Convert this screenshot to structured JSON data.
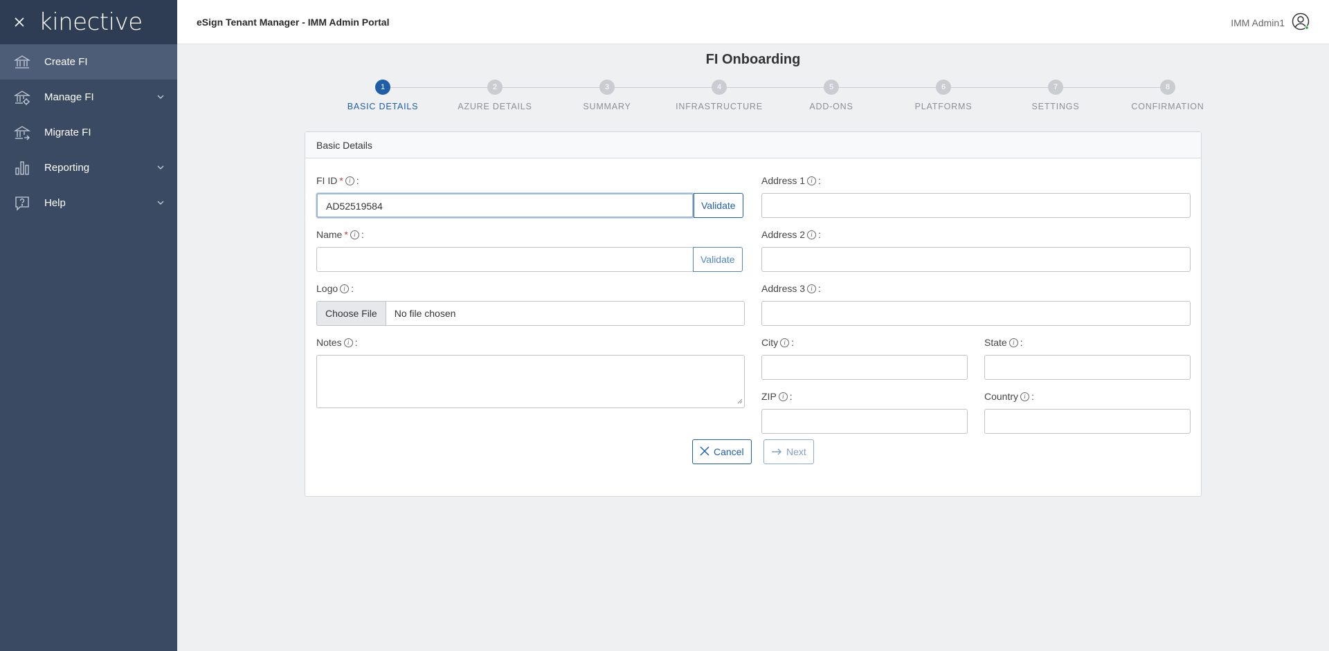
{
  "sidebar": {
    "logo": "kinective",
    "items": [
      {
        "label": "Create FI",
        "icon": "bank-icon",
        "active": true
      },
      {
        "label": "Manage FI",
        "icon": "bank-settings-icon",
        "expandable": true
      },
      {
        "label": "Migrate FI",
        "icon": "bank-migrate-icon"
      },
      {
        "label": "Reporting",
        "icon": "bar-chart-icon",
        "expandable": true
      },
      {
        "label": "Help",
        "icon": "help-icon",
        "expandable": true
      }
    ]
  },
  "header": {
    "title": "eSign Tenant Manager - IMM Admin Portal",
    "user": "IMM Admin1"
  },
  "page": {
    "title": "FI Onboarding"
  },
  "stepper": {
    "steps": [
      {
        "num": "1",
        "label": "BASIC DETAILS",
        "active": true
      },
      {
        "num": "2",
        "label": "AZURE DETAILS"
      },
      {
        "num": "3",
        "label": "SUMMARY"
      },
      {
        "num": "4",
        "label": "INFRASTRUCTURE"
      },
      {
        "num": "5",
        "label": "ADD-ONS"
      },
      {
        "num": "6",
        "label": "PLATFORMS"
      },
      {
        "num": "7",
        "label": "SETTINGS"
      },
      {
        "num": "8",
        "label": "CONFIRMATION"
      }
    ]
  },
  "form": {
    "section_title": "Basic Details",
    "fi_id": {
      "label": "FI ID",
      "required": "*",
      "suffix": ":",
      "value": "AD52519584",
      "validate": "Validate"
    },
    "name": {
      "label": "Name",
      "required": "*",
      "suffix": ":",
      "value": "",
      "validate": "Validate"
    },
    "logo": {
      "label": "Logo",
      "suffix": ":",
      "button": "Choose File",
      "status": "No file chosen"
    },
    "notes": {
      "label": "Notes",
      "suffix": ":"
    },
    "address1": {
      "label": "Address 1",
      "suffix": ":"
    },
    "address2": {
      "label": "Address 2",
      "suffix": ":"
    },
    "address3": {
      "label": "Address 3",
      "suffix": ":"
    },
    "city": {
      "label": "City",
      "suffix": ":"
    },
    "state": {
      "label": "State",
      "suffix": ":"
    },
    "zip": {
      "label": "ZIP",
      "suffix": ":"
    },
    "country": {
      "label": "Country",
      "suffix": ":"
    },
    "info_glyph": "i"
  },
  "actions": {
    "cancel": "Cancel",
    "next": "Next"
  },
  "colors": {
    "sidebar_bg": "#3a4a62",
    "accent": "#1e5ea8",
    "required": "#d3343a",
    "status_online": "#2ea44f"
  }
}
